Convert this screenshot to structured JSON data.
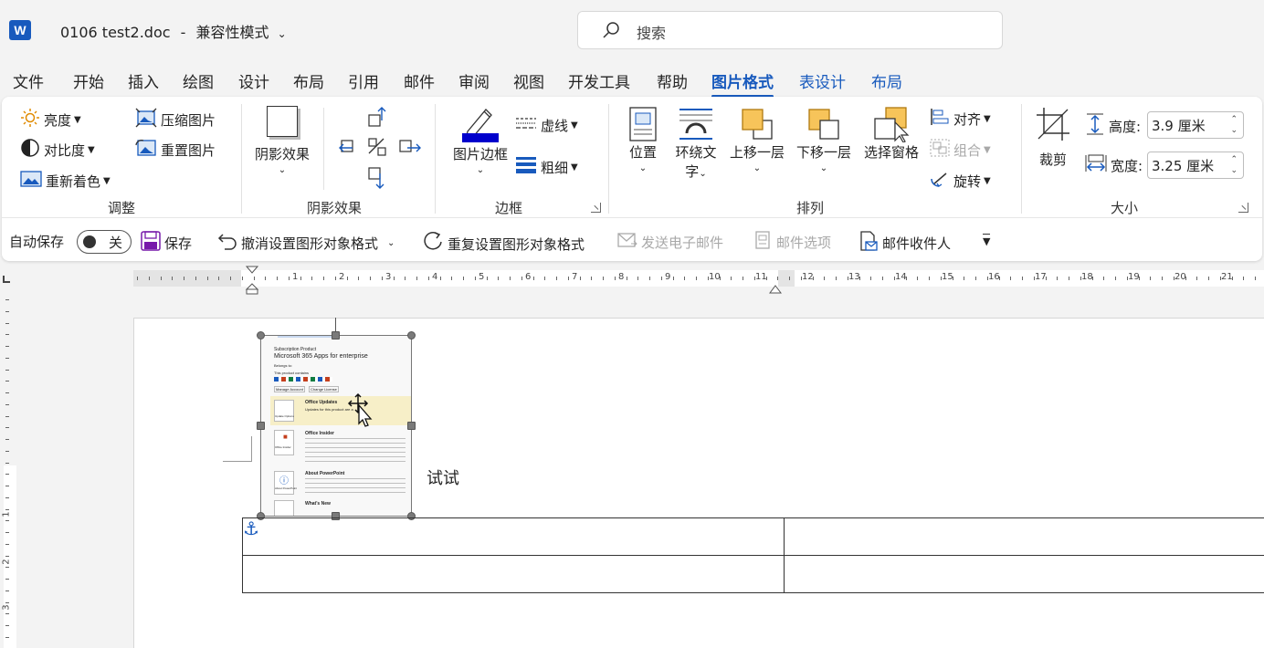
{
  "app": {
    "logo_letter": "W",
    "doc_title": "0106 test2.doc",
    "title_sep": "-",
    "mode": "兼容性模式",
    "search_placeholder": "搜索"
  },
  "tabs": [
    {
      "label": "文件"
    },
    {
      "label": "开始"
    },
    {
      "label": "插入"
    },
    {
      "label": "绘图"
    },
    {
      "label": "设计"
    },
    {
      "label": "布局"
    },
    {
      "label": "引用"
    },
    {
      "label": "邮件"
    },
    {
      "label": "审阅"
    },
    {
      "label": "视图"
    },
    {
      "label": "开发工具"
    },
    {
      "label": "帮助"
    },
    {
      "label": "图片格式"
    },
    {
      "label": "表设计"
    },
    {
      "label": "布局"
    }
  ],
  "ribbon": {
    "adjust": {
      "brightness": "亮度",
      "contrast": "对比度",
      "recolor": "重新着色",
      "compress": "压缩图片",
      "reset": "重置图片",
      "group": "调整"
    },
    "shadow": {
      "shadow_effects": "阴影效果",
      "group": "阴影效果"
    },
    "border": {
      "picture_border": "图片边框",
      "dashes": "虚线",
      "weight": "粗细",
      "group": "边框"
    },
    "arrange": {
      "position": "位置",
      "wrap_text_line1": "环绕文",
      "wrap_text_line2": "字",
      "bring_forward": "上移一层",
      "send_backward": "下移一层",
      "selection_pane": "选择窗格",
      "align": "对齐",
      "group_label": "组合",
      "rotate": "旋转",
      "group": "排列"
    },
    "size": {
      "crop": "裁剪",
      "height_label": "高度:",
      "height_value": "3.9 厘米",
      "width_label": "宽度:",
      "width_value": "3.25 厘米",
      "group": "大小"
    }
  },
  "qat": {
    "autosave": "自动保存",
    "autosave_state": "关",
    "save": "保存",
    "undo": "撤消设置图形对象格式",
    "redo": "重复设置图形对象格式",
    "send_email": "发送电子邮件",
    "mail_options": "邮件选项",
    "mail_recipient": "邮件收件人"
  },
  "ruler": {
    "h_numbers": [
      "1",
      "2",
      "3",
      "4",
      "5",
      "6",
      "7",
      "8",
      "9",
      "10",
      "11",
      "12",
      "13",
      "14",
      "15",
      "16",
      "17",
      "18",
      "19",
      "20",
      "21"
    ],
    "v_numbers": [
      "1",
      "2",
      "3"
    ]
  },
  "document": {
    "body_text": "试试",
    "image": {
      "subscription": "Subscription Product",
      "product": "Microsoft 365 Apps for enterprise",
      "belongs": "Belongs to:",
      "contains": "This product contains",
      "manage": "Manage Account",
      "change": "Change License",
      "updates_title": "Office Updates",
      "updates_desc": "Updates for this product are a",
      "update_options": "Update Options",
      "insider_title": "Office Insider",
      "insider_label": "Office Insider",
      "about_title": "About PowerPoint",
      "about_label": "About PowerPoint",
      "whats_new": "What's New"
    }
  },
  "colors": {
    "accent": "#185abd",
    "border_fill": "#0000cc"
  }
}
